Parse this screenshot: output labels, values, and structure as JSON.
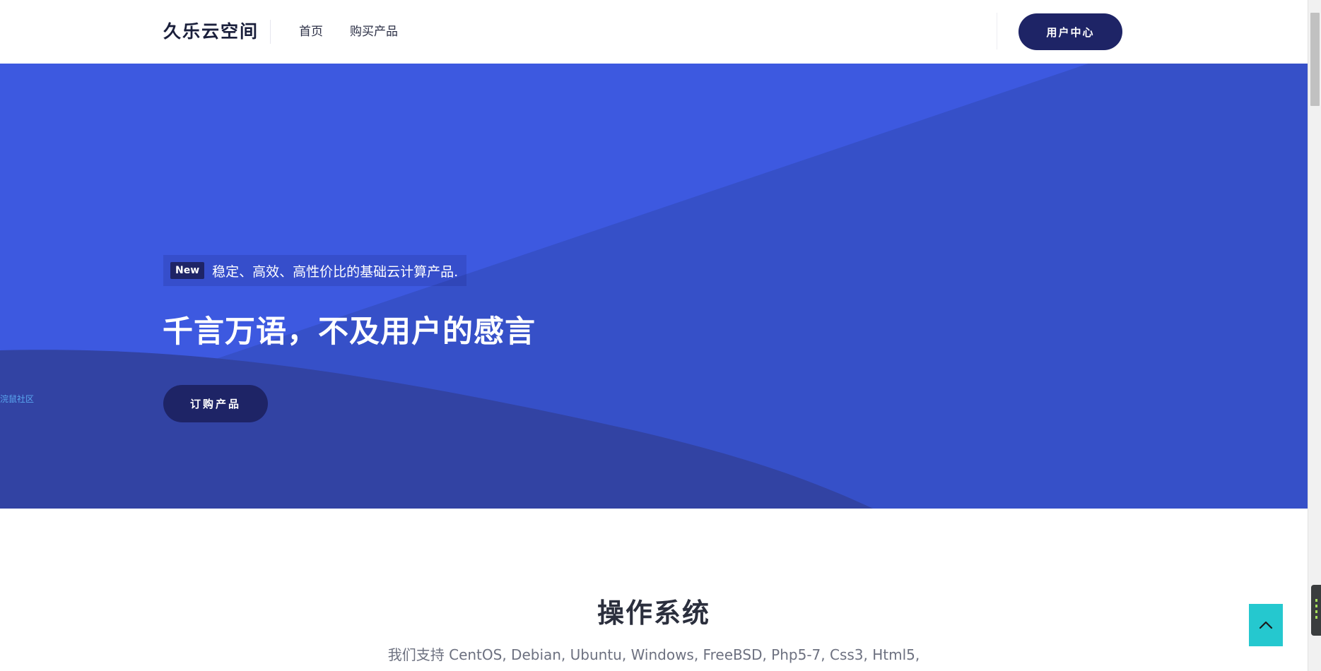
{
  "header": {
    "logo": "久乐云空间",
    "nav": [
      {
        "label": "首页"
      },
      {
        "label": "购买产品"
      }
    ],
    "user_center": "用户中心"
  },
  "hero": {
    "side_note": "浣鼠社区",
    "badge": "New",
    "tagline": "稳定、高效、高性价比的基础云计算产品.",
    "title": "千言万语，不及用户的感言",
    "order_button": "订购产品",
    "colors": {
      "base": "#3d59e0",
      "band": "#3650c8",
      "wave": "#3243a3",
      "button": "#1e2466"
    }
  },
  "os_section": {
    "title": "操作系统",
    "subtitle": "我们支持 CentOS, Debian, Ubuntu, Windows, FreeBSD, Php5-7, Css3, Html5,"
  },
  "back_to_top": {
    "icon": "chevron-up-icon",
    "color": "#25c8cf"
  }
}
